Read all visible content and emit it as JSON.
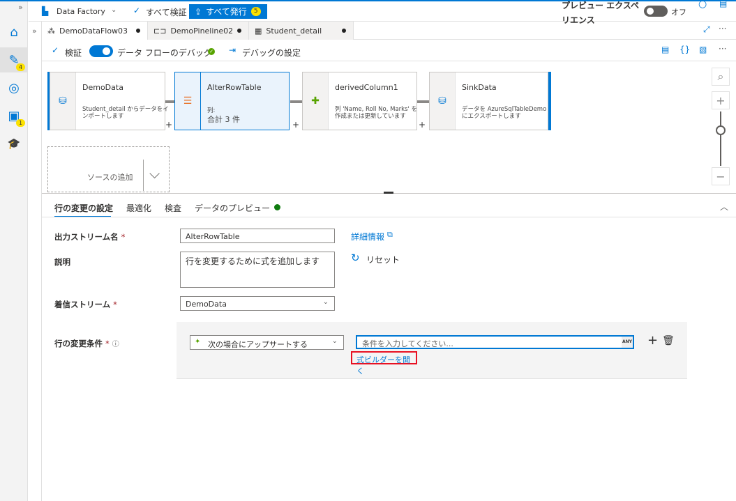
{
  "topbar": {
    "factory_name": "Data Factory",
    "validate_all": "すべて検証",
    "publish_all": "すべて発行",
    "publish_count": "5",
    "preview_experience": "プレビュー エクスペリエンス",
    "preview_state": "オフ"
  },
  "rail": {
    "author_badge": "4",
    "manage_badge": "1"
  },
  "tabs": [
    {
      "label": "DemoDataFlow03"
    },
    {
      "label": "DemoPineline02"
    },
    {
      "label": "Student_detail"
    }
  ],
  "toolbar": {
    "validate": "検証",
    "debug_label": "データ フローのデバッグ",
    "debug_settings": "デバッグの設定"
  },
  "nodes": [
    {
      "title": "DemoData",
      "desc": "Student_detail からデータをインポートします"
    },
    {
      "title": "AlterRowTable",
      "desc1": "列:",
      "desc2": "合計 3 件"
    },
    {
      "title": "derivedColumn1",
      "desc": "列 'Name, Roll No, Marks' を作成または更新しています"
    },
    {
      "title": "SinkData",
      "desc": "データを AzureSqlTableDemo にエクスポートします"
    }
  ],
  "add_source": "ソースの追加",
  "panel": {
    "tabs": [
      "行の変更の設定",
      "最適化",
      "検査",
      "データのプレビュー"
    ],
    "output_stream_label": "出力ストリーム名",
    "output_stream_value": "AlterRowTable",
    "learn_more": "詳細情報",
    "description_label": "説明",
    "description_value": "行を変更するために式を追加します",
    "reset": "リセット",
    "incoming_label": "着信ストリーム",
    "incoming_value": "DemoData",
    "condition_label": "行の変更条件",
    "condition_type": "次の場合にアップサートする",
    "condition_placeholder": "条件を入力してください...",
    "any_badge": "ANY",
    "expression_builder": "式ビルダーを開く"
  },
  "colors": {
    "accent": "#0078d4",
    "success": "#107c10",
    "required": "#a4262c",
    "highlight": "#e81123"
  }
}
